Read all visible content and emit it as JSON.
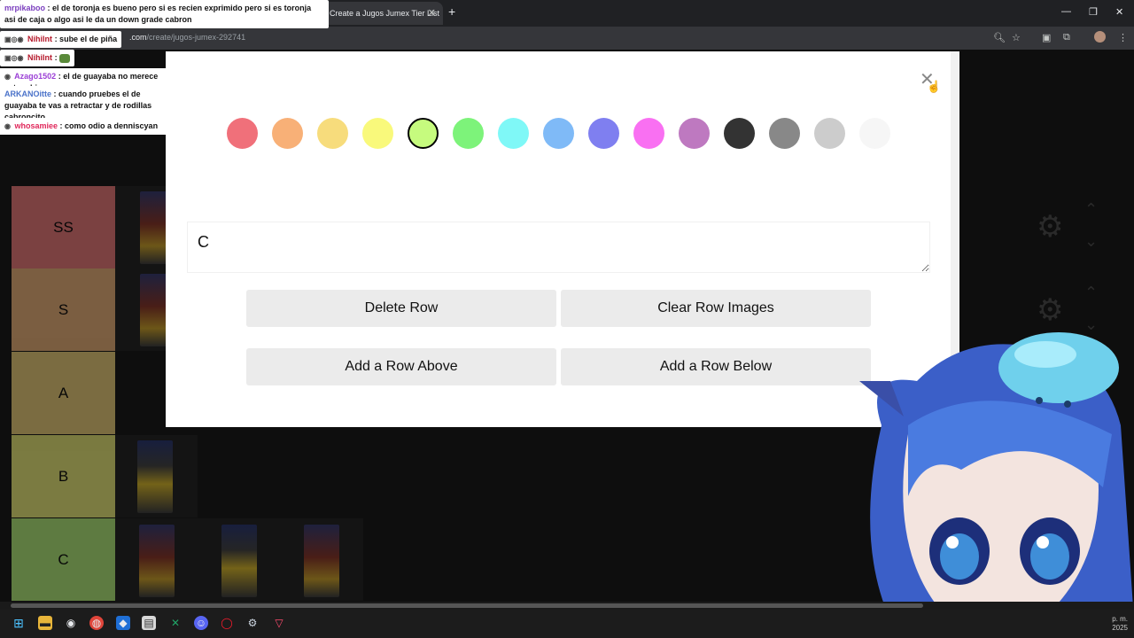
{
  "browser": {
    "tab_title": "Create a Jugos Jumex Tier List",
    "tab_close": "✕",
    "new_tab": "+",
    "url_domain": ".com",
    "url_path": "/create/jugos-jumex-292741"
  },
  "chat": {
    "messages": [
      {
        "user": "mrpikaboo",
        "text": ": el de toronja es bueno pero si es recien exprimido pero si es toronja asi de caja o algo asi le da un down grade cabron",
        "user_color": "#7b3fbf"
      },
      {
        "user": "Nihilnt",
        "text": ": sube el de piña",
        "user_color": "#b5172a"
      },
      {
        "user": "Nihilnt",
        "text": ":",
        "user_color": "#b5172a"
      },
      {
        "user": "Azago1502",
        "text": ": el de guayaba no merece estar ahi",
        "user_color": "#9b3fd6"
      },
      {
        "user": "ARKANOitte",
        "text": ": cuando pruebes el de guayaba te vas a retractar y de rodillas cabroncito",
        "user_color": "#4a72c9"
      },
      {
        "user": "whosamiee",
        "text": ": como odio a denniscyan",
        "user_color": "#e0285b"
      }
    ]
  },
  "tiers": [
    {
      "label": "SS",
      "color": "#ff7f7f"
    },
    {
      "label": "S",
      "color": "#ffbf7f"
    },
    {
      "label": "A",
      "color": "#ffdf7f"
    },
    {
      "label": "B",
      "color": "#ffff7f"
    },
    {
      "label": "C",
      "color": "#bfff7f"
    }
  ],
  "modal": {
    "close": "✕",
    "colors": [
      "#f0707a",
      "#f8b077",
      "#f7dc7c",
      "#f9f97b",
      "#c6fb7e",
      "#7df37a",
      "#7ff8f7",
      "#7fbaf7",
      "#7f7ff0",
      "#f970f2",
      "#be79c0",
      "#333333",
      "#888888",
      "#cccccc",
      "#f6f6f6"
    ],
    "selected_color_index": 4,
    "row_label": "C",
    "buttons": {
      "delete_row": "Delete Row",
      "clear_row_images": "Clear Row Images",
      "add_row_above": "Add a Row Above",
      "add_row_below": "Add a Row Below"
    }
  },
  "taskbar": {
    "time": "p. m.",
    "year": "2025"
  }
}
